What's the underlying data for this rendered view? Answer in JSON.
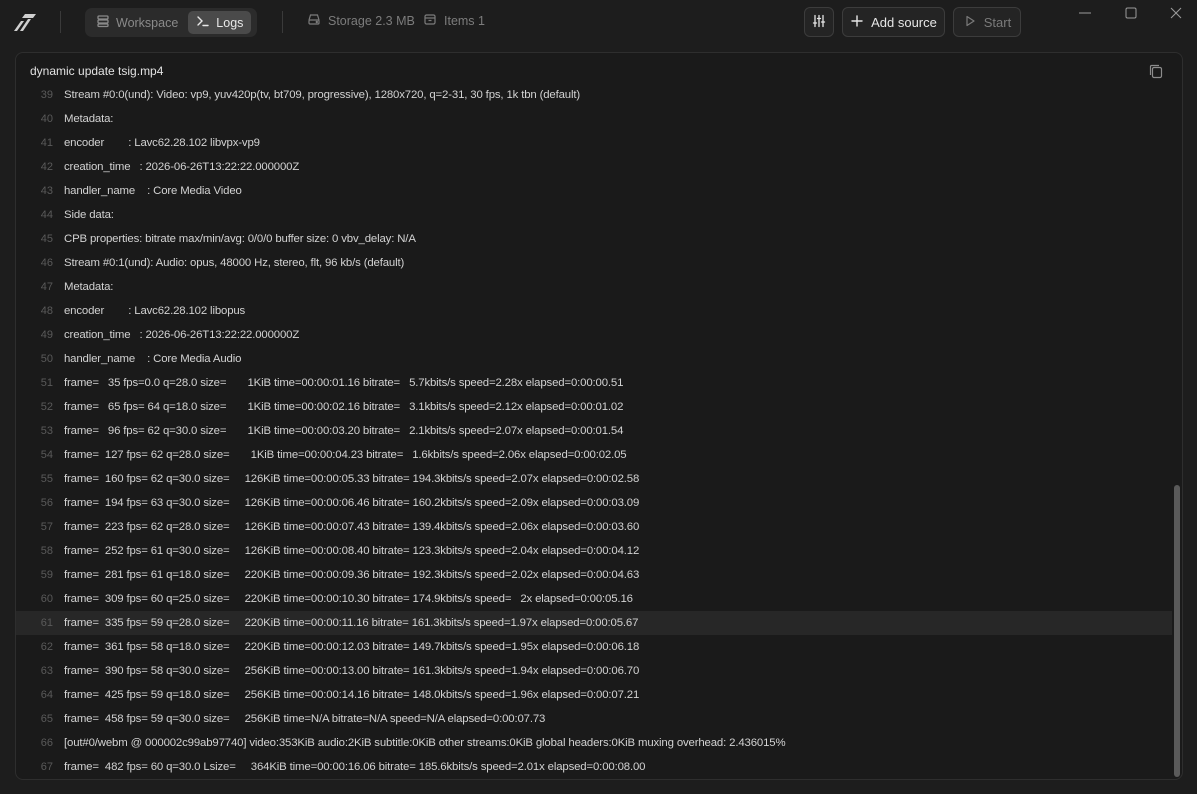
{
  "nav": {
    "workspace_label": "Workspace",
    "logs_label": "Logs"
  },
  "meta": {
    "storage_label": "Storage 2.3 MB",
    "items_label": "Items 1"
  },
  "toolbar": {
    "add_source_label": "Add source",
    "start_label": "Start"
  },
  "panel": {
    "title": "dynamic update tsig.mp4"
  },
  "log": {
    "highlighted_line": "61",
    "lines": [
      {
        "n": "39",
        "t": "Stream #0:0(und): Video: vp9, yuv420p(tv, bt709, progressive), 1280x720, q=2-31, 30 fps, 1k tbn (default)"
      },
      {
        "n": "40",
        "t": "Metadata:"
      },
      {
        "n": "41",
        "t": "encoder        : Lavc62.28.102 libvpx-vp9"
      },
      {
        "n": "42",
        "t": "creation_time   : 2026-06-26T13:22:22.000000Z"
      },
      {
        "n": "43",
        "t": "handler_name    : Core Media Video"
      },
      {
        "n": "44",
        "t": "Side data:"
      },
      {
        "n": "45",
        "t": "CPB properties: bitrate max/min/avg: 0/0/0 buffer size: 0 vbv_delay: N/A"
      },
      {
        "n": "46",
        "t": "Stream #0:1(und): Audio: opus, 48000 Hz, stereo, flt, 96 kb/s (default)"
      },
      {
        "n": "47",
        "t": "Metadata:"
      },
      {
        "n": "48",
        "t": "encoder        : Lavc62.28.102 libopus"
      },
      {
        "n": "49",
        "t": "creation_time   : 2026-06-26T13:22:22.000000Z"
      },
      {
        "n": "50",
        "t": "handler_name    : Core Media Audio"
      },
      {
        "n": "51",
        "t": "frame=   35 fps=0.0 q=28.0 size=       1KiB time=00:00:01.16 bitrate=   5.7kbits/s speed=2.28x elapsed=0:00:00.51"
      },
      {
        "n": "52",
        "t": "frame=   65 fps= 64 q=18.0 size=       1KiB time=00:00:02.16 bitrate=   3.1kbits/s speed=2.12x elapsed=0:00:01.02"
      },
      {
        "n": "53",
        "t": "frame=   96 fps= 62 q=30.0 size=       1KiB time=00:00:03.20 bitrate=   2.1kbits/s speed=2.07x elapsed=0:00:01.54"
      },
      {
        "n": "54",
        "t": "frame=  127 fps= 62 q=28.0 size=       1KiB time=00:00:04.23 bitrate=   1.6kbits/s speed=2.06x elapsed=0:00:02.05"
      },
      {
        "n": "55",
        "t": "frame=  160 fps= 62 q=30.0 size=     126KiB time=00:00:05.33 bitrate= 194.3kbits/s speed=2.07x elapsed=0:00:02.58"
      },
      {
        "n": "56",
        "t": "frame=  194 fps= 63 q=30.0 size=     126KiB time=00:00:06.46 bitrate= 160.2kbits/s speed=2.09x elapsed=0:00:03.09"
      },
      {
        "n": "57",
        "t": "frame=  223 fps= 62 q=28.0 size=     126KiB time=00:00:07.43 bitrate= 139.4kbits/s speed=2.06x elapsed=0:00:03.60"
      },
      {
        "n": "58",
        "t": "frame=  252 fps= 61 q=30.0 size=     126KiB time=00:00:08.40 bitrate= 123.3kbits/s speed=2.04x elapsed=0:00:04.12"
      },
      {
        "n": "59",
        "t": "frame=  281 fps= 61 q=18.0 size=     220KiB time=00:00:09.36 bitrate= 192.3kbits/s speed=2.02x elapsed=0:00:04.63"
      },
      {
        "n": "60",
        "t": "frame=  309 fps= 60 q=25.0 size=     220KiB time=00:00:10.30 bitrate= 174.9kbits/s speed=   2x elapsed=0:00:05.16"
      },
      {
        "n": "61",
        "t": "frame=  335 fps= 59 q=28.0 size=     220KiB time=00:00:11.16 bitrate= 161.3kbits/s speed=1.97x elapsed=0:00:05.67"
      },
      {
        "n": "62",
        "t": "frame=  361 fps= 58 q=18.0 size=     220KiB time=00:00:12.03 bitrate= 149.7kbits/s speed=1.95x elapsed=0:00:06.18"
      },
      {
        "n": "63",
        "t": "frame=  390 fps= 58 q=30.0 size=     256KiB time=00:00:13.00 bitrate= 161.3kbits/s speed=1.94x elapsed=0:00:06.70"
      },
      {
        "n": "64",
        "t": "frame=  425 fps= 59 q=18.0 size=     256KiB time=00:00:14.16 bitrate= 148.0kbits/s speed=1.96x elapsed=0:00:07.21"
      },
      {
        "n": "65",
        "t": "frame=  458 fps= 59 q=30.0 size=     256KiB time=N/A bitrate=N/A speed=N/A elapsed=0:00:07.73"
      },
      {
        "n": "66",
        "t": "[out#0/webm @ 000002c99ab97740] video:353KiB audio:2KiB subtitle:0KiB other streams:0KiB global headers:0KiB muxing overhead: 2.436015%"
      },
      {
        "n": "67",
        "t": "frame=  482 fps= 60 q=30.0 Lsize=     364KiB time=00:00:16.06 bitrate= 185.6kbits/s speed=2.01x elapsed=0:00:08.00"
      }
    ]
  }
}
